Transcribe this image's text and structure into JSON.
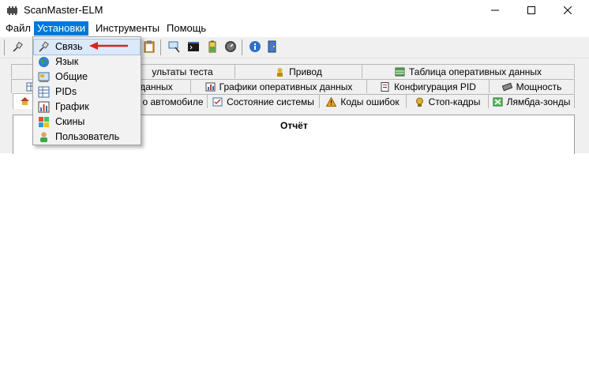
{
  "window": {
    "title": "ScanMaster-ELM"
  },
  "menubar": {
    "file": "Файл",
    "settings": "Установки",
    "tools": "Инструменты",
    "help": "Помощь"
  },
  "dropdown": {
    "items": [
      {
        "label": "Связь",
        "icon": "connection-icon"
      },
      {
        "label": "Язык",
        "icon": "globe-icon"
      },
      {
        "label": "Общие",
        "icon": "general-icon"
      },
      {
        "label": "PIDs",
        "icon": "pids-icon"
      },
      {
        "label": "График",
        "icon": "graph-icon"
      },
      {
        "label": "Скины",
        "icon": "skins-icon"
      },
      {
        "label": "Пользователь",
        "icon": "user-icon"
      }
    ]
  },
  "tabs": {
    "row1": [
      "ультаты теста",
      "Привод",
      "Таблица оперативных данных"
    ],
    "row2": [
      "данных",
      "Графики оперативных данных",
      "Конфигурация PID",
      "Мощность"
    ],
    "row3": [
      "о автомобиле",
      "Состояние системы",
      "Коды ошибок",
      "Стоп-кадры",
      "Лямбда-зонды"
    ]
  },
  "report": {
    "title": "Отчёт"
  },
  "colors": {
    "menu_highlight": "#0078d7",
    "annotation_arrow": "#e02020"
  }
}
